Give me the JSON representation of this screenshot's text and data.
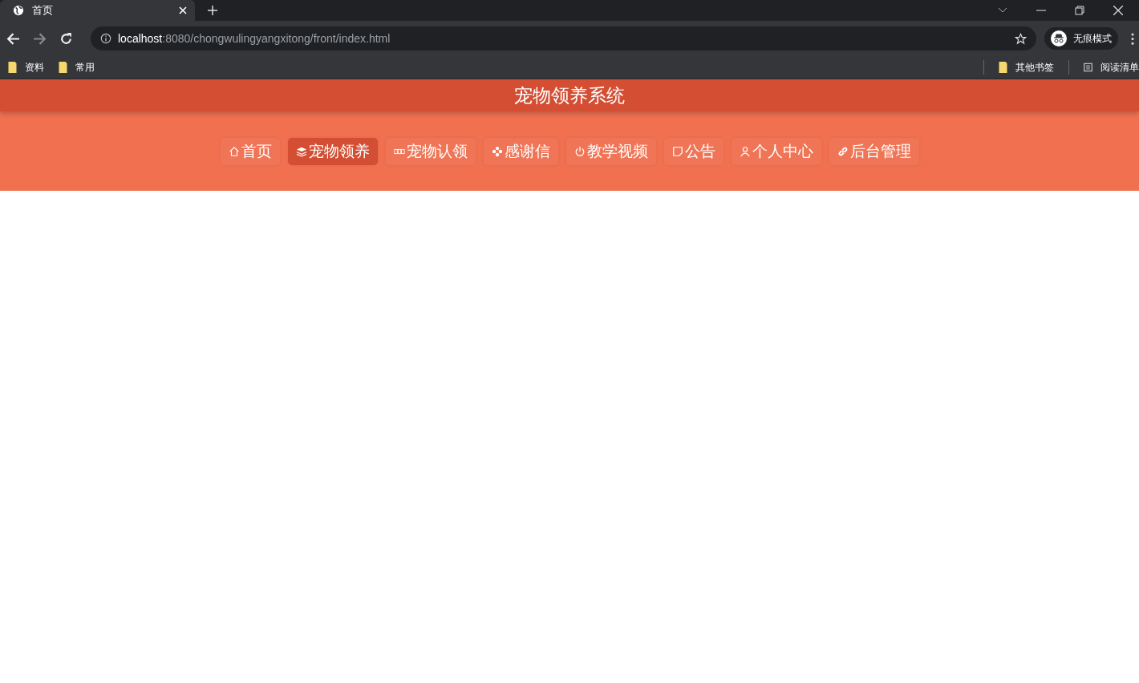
{
  "browser": {
    "tab": {
      "title": "首页"
    },
    "url": {
      "host": "localhost",
      "path": ":8080/chongwulingyangxitong/front/index.html"
    },
    "profile": "无痕模式",
    "bookmarks": [
      "资料",
      "常用"
    ],
    "other_bookmarks": "其他书签",
    "reading_list": "阅读清单"
  },
  "site": {
    "title": "宠物领养系统",
    "nav": [
      {
        "label": "首页",
        "kind": "home",
        "selected": false
      },
      {
        "label": "宠物领养",
        "kind": "layers",
        "selected": true
      },
      {
        "label": "宠物认领",
        "kind": "grid",
        "selected": false
      },
      {
        "label": "感谢信",
        "kind": "flower",
        "selected": false
      },
      {
        "label": "教学视频",
        "kind": "power",
        "selected": false
      },
      {
        "label": "公告",
        "kind": "note",
        "selected": false
      },
      {
        "label": "个人中心",
        "kind": "user",
        "selected": false
      },
      {
        "label": "后台管理",
        "kind": "link",
        "selected": false
      }
    ]
  }
}
